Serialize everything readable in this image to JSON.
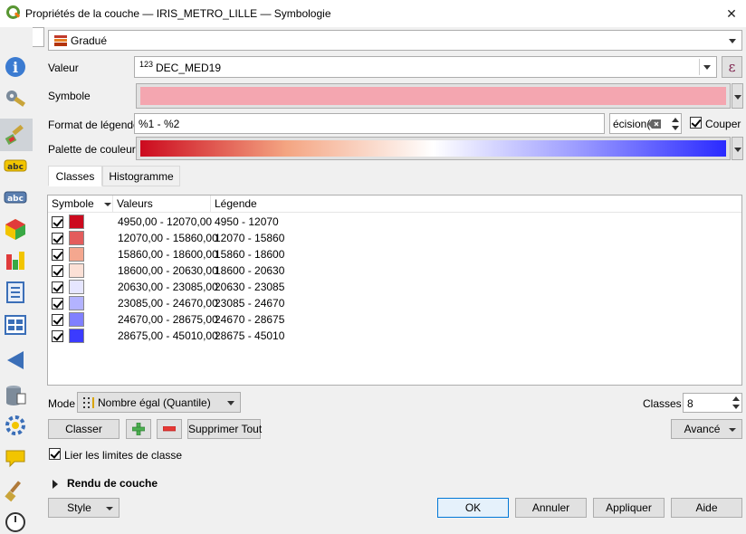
{
  "window": {
    "title": "Propriétés de la couche — IRIS_METRO_LILLE — Symbologie",
    "close_label": "✕"
  },
  "renderer": {
    "selected": "Gradué"
  },
  "fields": {
    "valeur_label": "Valeur",
    "valeur_type": "123",
    "valeur_value": "DEC_MED19",
    "expression_label": "ε",
    "symbole_label": "Symbole",
    "symbol_color": "#f4a6b0",
    "format_label": "Format de légende",
    "format_value": "%1 - %2",
    "precision_value": "écision(",
    "couper_label": "Couper",
    "palette_label": "Palette de couleur",
    "palette_colors": [
      "#cc0a1e",
      "#f4a582",
      "#ffffff",
      "#9a9aff",
      "#2a2aff"
    ]
  },
  "tabs": [
    {
      "label": "Classes",
      "active": true
    },
    {
      "label": "Histogramme",
      "active": false
    }
  ],
  "table": {
    "headers": [
      "Symbole",
      "Valeurs",
      "Légende"
    ],
    "rows": [
      {
        "color": "#cc0a1e",
        "values": "4950,00 - 12070,00",
        "legend": "4950 - 12070"
      },
      {
        "color": "#e35c5c",
        "values": "12070,00 - 15860,00",
        "legend": "12070 - 15860"
      },
      {
        "color": "#f4a78f",
        "values": "15860,00 - 18600,00",
        "legend": "15860 - 18600"
      },
      {
        "color": "#fbe0d6",
        "values": "18600,00 - 20630,00",
        "legend": "18600 - 20630"
      },
      {
        "color": "#e6e6ff",
        "values": "20630,00 - 23085,00",
        "legend": "20630 - 23085"
      },
      {
        "color": "#b3b3ff",
        "values": "23085,00 - 24670,00",
        "legend": "23085 - 24670"
      },
      {
        "color": "#8080ff",
        "values": "24670,00 - 28675,00",
        "legend": "24670 - 28675"
      },
      {
        "color": "#3b3bff",
        "values": "28675,00 - 45010,00",
        "legend": "28675 - 45010"
      }
    ]
  },
  "mode": {
    "label": "Mode",
    "value": "Nombre égal (Quantile)"
  },
  "classes": {
    "label": "Classes",
    "value": "8"
  },
  "buttons": {
    "classer": "Classer",
    "supprimer_tout": "Supprimer Tout",
    "avance": "Avancé",
    "style": "Style",
    "ok": "OK",
    "annuler": "Annuler",
    "appliquer": "Appliquer",
    "aide": "Aide"
  },
  "lier_label": "Lier les limites de classe",
  "rendu_label": "Rendu de couche"
}
